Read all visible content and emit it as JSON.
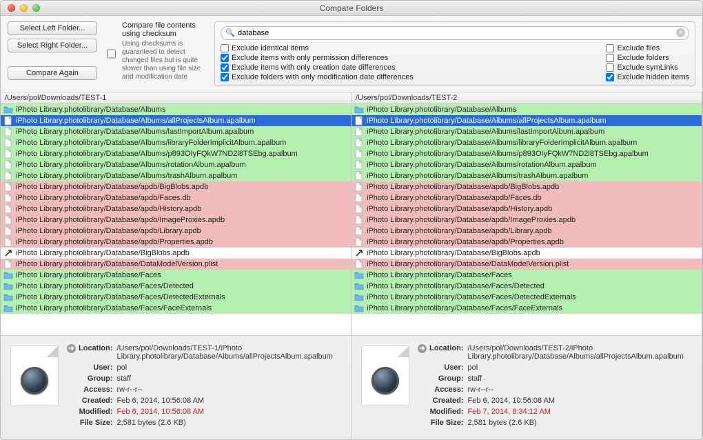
{
  "window": {
    "title": "Compare Folders"
  },
  "buttons": {
    "select_left": "Select Left Folder...",
    "select_right": "Select Right Folder...",
    "compare_again": "Compare Again"
  },
  "checksum": {
    "label": "Compare file contents using checksum",
    "checked": false,
    "hint": "Using checksums is guaranteed to detect changed files but is quite slower than using file size and modification date"
  },
  "search": {
    "value": "database",
    "placeholder": ""
  },
  "filters_left": [
    {
      "id": "exclude-identical",
      "label": "Exclude identical items",
      "checked": false
    },
    {
      "id": "exclude-perm",
      "label": "Exclude items with only permission differences",
      "checked": true
    },
    {
      "id": "exclude-created",
      "label": "Exclude items with only creation date differences",
      "checked": true
    },
    {
      "id": "exclude-mod",
      "label": "Exclude folders with only modification date differences",
      "checked": true
    }
  ],
  "filters_right": [
    {
      "id": "exclude-files",
      "label": "Exclude files",
      "checked": false
    },
    {
      "id": "exclude-folders",
      "label": "Exclude folders",
      "checked": false
    },
    {
      "id": "exclude-symlinks",
      "label": "Exclude symLinks",
      "checked": false
    },
    {
      "id": "exclude-hidden",
      "label": "Exclude hidden items",
      "checked": true
    }
  ],
  "headers": {
    "left": "/Users/pol/Downloads/TEST-1",
    "right": "/Users/pol/Downloads/TEST-2"
  },
  "rows": [
    {
      "icon": "folder",
      "status": "green",
      "path": "iPhoto Library.photolibrary/Database/Albums"
    },
    {
      "icon": "file",
      "status": "sel",
      "path": "iPhoto Library.photolibrary/Database/Albums/allProjectsAlbum.apalbum"
    },
    {
      "icon": "file",
      "status": "green",
      "path": "iPhoto Library.photolibrary/Database/Albums/lastImportAlbum.apalbum"
    },
    {
      "icon": "file",
      "status": "green",
      "path": "iPhoto Library.photolibrary/Database/Albums/libraryFolderImplicitAlbum.apalbum"
    },
    {
      "icon": "file",
      "status": "green",
      "path": "iPhoto Library.photolibrary/Database/Albums/p893OIyFQkW7ND2l8TSEbg.apalbum"
    },
    {
      "icon": "file",
      "status": "green",
      "path": "iPhoto Library.photolibrary/Database/Albums/rotationAlbum.apalbum"
    },
    {
      "icon": "file",
      "status": "green",
      "path": "iPhoto Library.photolibrary/Database/Albums/trashAlbum.apalbum"
    },
    {
      "icon": "file",
      "status": "pink",
      "path": "iPhoto Library.photolibrary/Database/apdb/BigBlobs.apdb"
    },
    {
      "icon": "file",
      "status": "pink",
      "path": "iPhoto Library.photolibrary/Database/apdb/Faces.db"
    },
    {
      "icon": "file",
      "status": "pink",
      "path": "iPhoto Library.photolibrary/Database/apdb/History.apdb"
    },
    {
      "icon": "file",
      "status": "pink",
      "path": "iPhoto Library.photolibrary/Database/apdb/ImageProxies.apdb"
    },
    {
      "icon": "file",
      "status": "pink",
      "path": "iPhoto Library.photolibrary/Database/apdb/Library.apdb"
    },
    {
      "icon": "file",
      "status": "pink",
      "path": "iPhoto Library.photolibrary/Database/apdb/Properties.apdb"
    },
    {
      "icon": "alias",
      "status": "white",
      "path": "iPhoto Library.photolibrary/Database/BigBlobs.apdb"
    },
    {
      "icon": "file",
      "status": "pink",
      "path": "iPhoto Library.photolibrary/Database/DataModelVersion.plist"
    },
    {
      "icon": "folder",
      "status": "green",
      "path": "iPhoto Library.photolibrary/Database/Faces"
    },
    {
      "icon": "folder",
      "status": "green",
      "path": "iPhoto Library.photolibrary/Database/Faces/Detected"
    },
    {
      "icon": "folder",
      "status": "green",
      "path": "iPhoto Library.photolibrary/Database/Faces/DetectedExternals"
    },
    {
      "icon": "folder",
      "status": "green",
      "path": "iPhoto Library.photolibrary/Database/Faces/FaceExternals"
    }
  ],
  "detail_labels": {
    "location": "Location:",
    "user": "User:",
    "group": "Group:",
    "access": "Access:",
    "created": "Created:",
    "modified": "Modified:",
    "filesize": "File Size:"
  },
  "detail_left": {
    "location": "/Users/pol/Downloads/TEST-1/iPhoto Library.photolibrary/Database/Albums/allProjectsAlbum.apalbum",
    "user": "pol",
    "group": "staff",
    "access": "rw-r--r--",
    "created": "Feb 6, 2014, 10:56:08 AM",
    "modified": "Feb 6, 2014, 10:56:08 AM",
    "modified_diff": true,
    "filesize": "2,581 bytes (2.6 KB)"
  },
  "detail_right": {
    "location": "/Users/pol/Downloads/TEST-2/iPhoto Library.photolibrary/Database/Albums/allProjectsAlbum.apalbum",
    "user": "pol",
    "group": "staff",
    "access": "rw-r--r--",
    "created": "Feb 6, 2014, 10:56:08 AM",
    "modified": "Feb 7, 2014, 8:34:12 AM",
    "modified_diff": true,
    "filesize": "2,581 bytes (2.6 KB)"
  }
}
